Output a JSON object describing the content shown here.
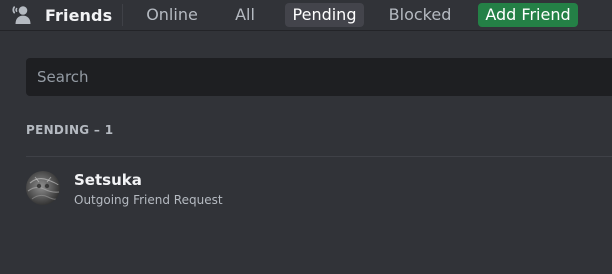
{
  "header": {
    "title": "Friends",
    "title_icon": "friends-wave-icon",
    "tabs": [
      {
        "label": "Online"
      },
      {
        "label": "All"
      },
      {
        "label": "Pending",
        "selected": true
      },
      {
        "label": "Blocked"
      }
    ],
    "add_friend_label": "Add Friend"
  },
  "search": {
    "placeholder": "Search",
    "value": ""
  },
  "list": {
    "section_title": "PENDING – 1",
    "items": [
      {
        "name": "Setsuka",
        "status": "Outgoing Friend Request",
        "avatar_icon": "user-avatar"
      }
    ]
  },
  "colors": {
    "background": "#313338",
    "search_bg": "#1e1f22",
    "selected_tab_bg": "#43444b",
    "add_friend_bg": "#248046",
    "text_primary": "#f2f3f5",
    "text_muted": "#b5bac1"
  }
}
